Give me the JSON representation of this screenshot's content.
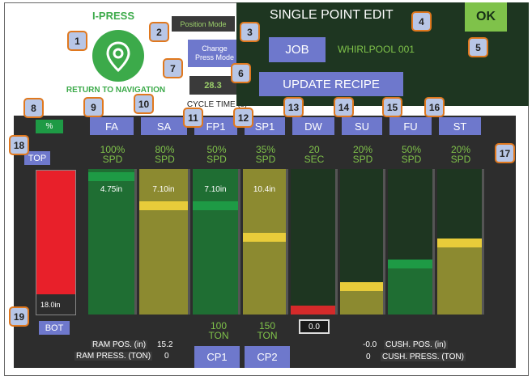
{
  "app": {
    "title": "I-PRESS",
    "return_label": "RETURN TO NAVIGATION"
  },
  "top": {
    "position_mode": "Position Mode",
    "change_press_mode": "Change Press Mode",
    "cycle_time_value": "28.3",
    "cycle_time_label": "CYCLE TIME (s)"
  },
  "panel": {
    "title": "SINGLE POINT EDIT",
    "ok": "OK",
    "job": "JOB",
    "job_name": "WHIRLPOOL 001",
    "update_recipe": "UPDATE RECIPE"
  },
  "callouts": [
    "1",
    "2",
    "3",
    "4",
    "5",
    "6",
    "7",
    "8",
    "9",
    "10",
    "11",
    "12",
    "13",
    "14",
    "15",
    "16",
    "17",
    "18",
    "19"
  ],
  "percent_btn": "%",
  "columns": [
    {
      "head": "FA",
      "spd": "100%",
      "unit": "SPD",
      "bar": 1.0,
      "fill_color": "#1f6e33",
      "level": 0.98,
      "level_color": "#1e9a45",
      "value": "4.75in",
      "value_color": "#1e9a45"
    },
    {
      "head": "SA",
      "spd": "80%",
      "unit": "SPD",
      "bar": 1.0,
      "fill_color": "#8c8a30",
      "level": 0.78,
      "level_color": "#e8cc3a",
      "value": "7.10in",
      "value_color": "#8c8a30"
    },
    {
      "head": "FP1",
      "spd": "50%",
      "unit": "SPD",
      "bar": 1.0,
      "fill_color": "#1f6e33",
      "level": 0.78,
      "level_color": "#1e9a45",
      "value": "7.10in",
      "value_color": "#1f6e33"
    },
    {
      "head": "SP1",
      "spd": "35%",
      "unit": "SPD",
      "bar": 1.0,
      "fill_color": "#8c8a30",
      "level": 0.56,
      "level_color": "#e8cc3a",
      "value": "10.4in",
      "value_color": "#8c8a30"
    },
    {
      "head": "DW",
      "spd": "20",
      "unit": "SEC",
      "bar": 0.0,
      "fill_color": "#1e3621",
      "level": 0.02,
      "level_color": "#d42a2a",
      "value": "",
      "value_color": ""
    },
    {
      "head": "SU",
      "spd": "20%",
      "unit": "SPD",
      "bar": 0.22,
      "fill_color": "#8c8a30",
      "level": 0.22,
      "level_color": "#e8cc3a",
      "value": "",
      "value_color": ""
    },
    {
      "head": "FU",
      "spd": "50%",
      "unit": "SPD",
      "bar": 0.38,
      "fill_color": "#1f6e33",
      "level": 0.38,
      "level_color": "#1e9a45",
      "value": "",
      "value_color": ""
    },
    {
      "head": "ST",
      "spd": "20%",
      "unit": "SPD",
      "bar": 0.52,
      "fill_color": "#8c8a30",
      "level": 0.52,
      "level_color": "#e8cc3a",
      "value": "",
      "value_color": ""
    }
  ],
  "ram": {
    "top": "TOP",
    "bot": "BOT",
    "fill_fraction": 0.86,
    "reading": "18.0in"
  },
  "bottom": {
    "ram_pos_label": "RAM POS. (in)",
    "ram_pos_value": "15.2",
    "ram_press_label": "RAM PRESS. (TON)",
    "ram_press_value": "0",
    "cp1_ton": "100",
    "cp1_unit": "TON",
    "cp1": "CP1",
    "cp2_ton": "150",
    "cp2_unit": "TON",
    "cp2": "CP2",
    "dwell_value": "0.0",
    "cush_pos_value": "-0.0",
    "cush_pos_label": "CUSH. POS. (in)",
    "cush_press_value": "0",
    "cush_press_label": "CUSH. PRESS. (TON)"
  },
  "colors": {
    "accent_green": "#7fc24a",
    "button_blue": "#6e78cc",
    "callout_border": "#e0781e",
    "ram_red": "#e8202a"
  }
}
